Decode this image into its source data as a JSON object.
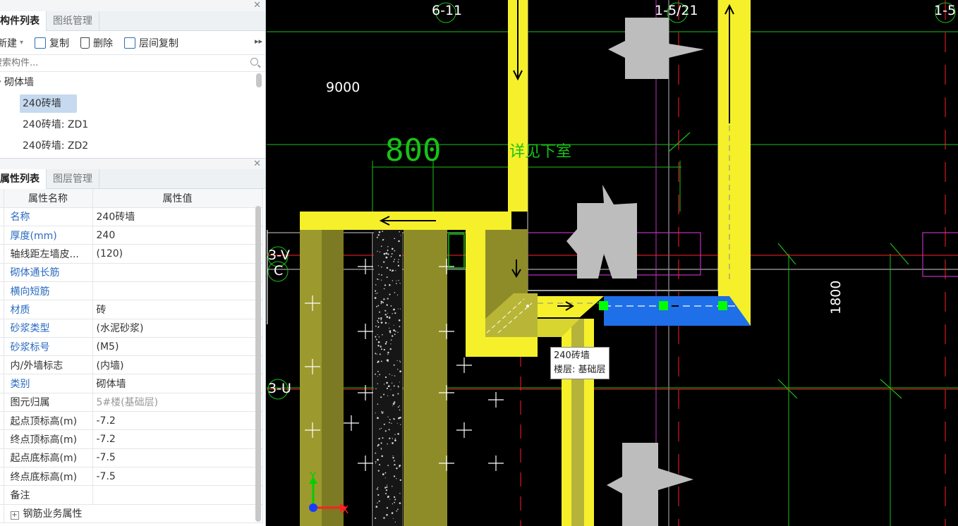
{
  "component_panel": {
    "tabs": [
      {
        "label": "构件列表",
        "active": true
      },
      {
        "label": "图纸管理",
        "active": false
      }
    ],
    "toolbar": {
      "new_label": "新建",
      "copy_label": "复制",
      "delete_label": "删除",
      "floor_copy_label": "层间复制",
      "more_glyph": "▸▸"
    },
    "search": {
      "placeholder": "搜索构件..."
    },
    "tree": {
      "group": "砌体墙",
      "items": [
        "240砖墙",
        "240砖墙: ZD1",
        "240砖墙: ZD2"
      ],
      "selected_index": 0
    }
  },
  "property_panel": {
    "tabs": [
      {
        "label": "属性列表",
        "active": true
      },
      {
        "label": "图层管理",
        "active": false
      }
    ],
    "headers": {
      "name": "属性名称",
      "value": "属性值"
    },
    "rows": [
      {
        "name": "名称",
        "value": "240砖墙",
        "blue": true
      },
      {
        "name": "厚度(mm)",
        "value": "240",
        "blue": true
      },
      {
        "name": "轴线距左墙皮...",
        "value": "(120)",
        "blue": false
      },
      {
        "name": "砌体通长筋",
        "value": "",
        "blue": true
      },
      {
        "name": "横向短筋",
        "value": "",
        "blue": true
      },
      {
        "name": "材质",
        "value": "砖",
        "blue": true
      },
      {
        "name": "砂浆类型",
        "value": "(水泥砂浆)",
        "blue": true
      },
      {
        "name": "砂浆标号",
        "value": "(M5)",
        "blue": true
      },
      {
        "name": "内/外墙标志",
        "value": "(内墙)",
        "blue": false
      },
      {
        "name": "类别",
        "value": "砌体墙",
        "blue": true
      },
      {
        "name": "图元归属",
        "value": "5#楼(基础层)",
        "blue": false,
        "gray": true
      },
      {
        "name": "起点顶标高(m)",
        "value": "-7.2",
        "blue": false
      },
      {
        "name": "终点顶标高(m)",
        "value": "-7.2",
        "blue": false
      },
      {
        "name": "起点底标高(m)",
        "value": "-7.5",
        "blue": false
      },
      {
        "name": "终点底标高(m)",
        "value": "-7.5",
        "blue": false
      },
      {
        "name": "备注",
        "value": "",
        "blue": false
      }
    ],
    "expand_group": "钢筋业务属性"
  },
  "canvas": {
    "axis_labels": {
      "top_left": "6-11",
      "top_mid": "1-5/21",
      "top_right": "1-5",
      "row_c_v": "3-V",
      "row_c": "C",
      "row_u": "3-U"
    },
    "dimensions": {
      "d9000": "9000",
      "d800": "800",
      "d1800": "1800",
      "note": "详见下室"
    },
    "tooltip": {
      "line1": "240砖墙",
      "line2": "楼层: 基础层"
    },
    "coord_axes": {
      "x": "X",
      "y": "Y"
    },
    "colors": {
      "wall_yellow": "#f5f02a",
      "wall_olive": "#9c9a2e",
      "selected_blue": "#1e6fe8",
      "grip_green": "#00ff00",
      "axis_red": "#ff2020",
      "dim_green": "#17c217",
      "magenta": "#c030c0",
      "gray_fill": "#bdbdbd"
    }
  }
}
